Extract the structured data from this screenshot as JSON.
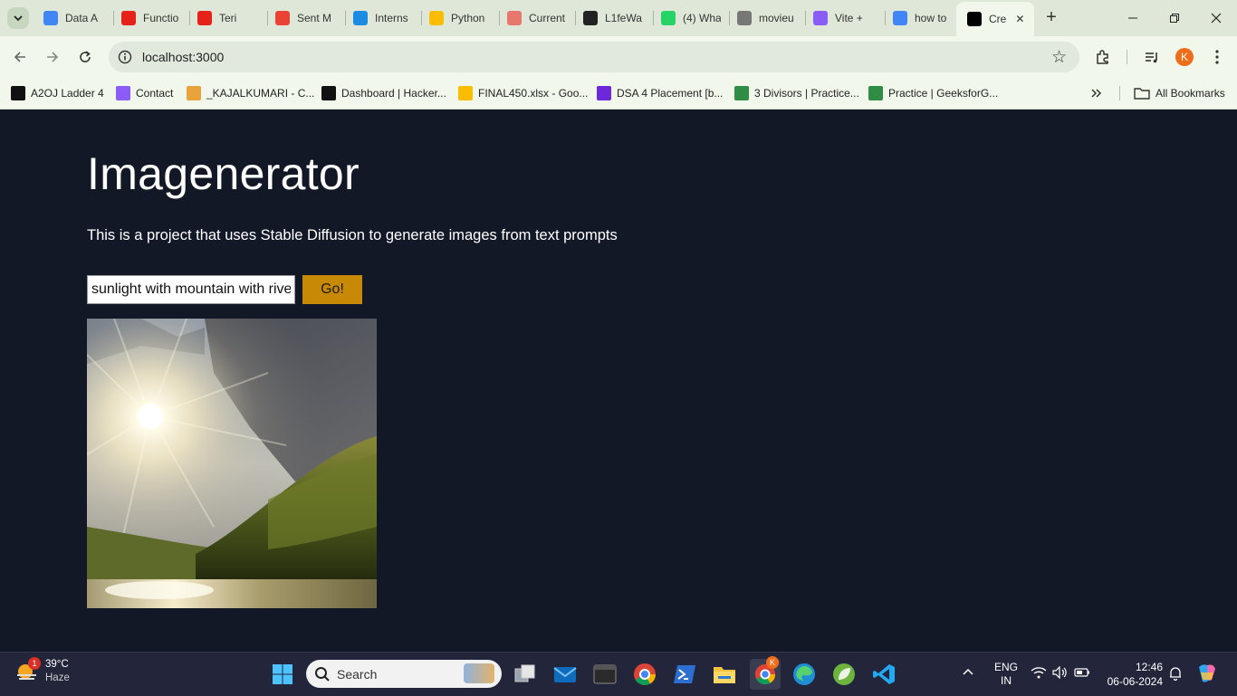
{
  "browser": {
    "tabs": [
      {
        "title": "Data A",
        "favicon": "docs-icon",
        "color": "#4285f4"
      },
      {
        "title": "Functio",
        "favicon": "youtube-icon",
        "color": "#e62117"
      },
      {
        "title": "Teri",
        "favicon": "youtube-icon",
        "color": "#e62117"
      },
      {
        "title": "Sent M",
        "favicon": "gmail-icon",
        "color": "#ea4335"
      },
      {
        "title": "Interns",
        "favicon": "internshala-icon",
        "color": "#1c8ce3"
      },
      {
        "title": "Python",
        "favicon": "drive-icon",
        "color": "#fbbc04"
      },
      {
        "title": "Current",
        "favicon": "claude-icon",
        "color": "#e8776e"
      },
      {
        "title": "L1feWa",
        "favicon": "github-icon",
        "color": "#222222"
      },
      {
        "title": "(4) Wha",
        "favicon": "whatsapp-icon",
        "color": "#25d366"
      },
      {
        "title": "movieu",
        "favicon": "globe-icon",
        "color": "#777777"
      },
      {
        "title": "Vite +",
        "favicon": "vite-icon",
        "color": "#8b5cf6"
      },
      {
        "title": "how to",
        "favicon": "google-icon",
        "color": "#4285f4"
      },
      {
        "title": "Cre",
        "favicon": "nextjs-icon",
        "color": "#000000"
      }
    ],
    "url": "localhost:3000",
    "bookmarks": [
      {
        "label": "A2OJ Ladder 4",
        "icon": "a2oj-icon"
      },
      {
        "label": "Contact",
        "icon": "vite-icon"
      },
      {
        "label": "_KAJALKUMARI - C...",
        "icon": "chart-icon"
      },
      {
        "label": "Dashboard | Hacker...",
        "icon": "hackerrank-icon"
      },
      {
        "label": "FINAL450.xlsx - Goo...",
        "icon": "drive-icon"
      },
      {
        "label": "DSA 4 Placement [b...",
        "icon": "presentation-icon"
      },
      {
        "label": "3 Divisors | Practice...",
        "icon": "geeksforgeeks-icon"
      },
      {
        "label": "Practice | GeeksforG...",
        "icon": "geeksforgeeks-icon"
      }
    ],
    "all_bookmarks": "All Bookmarks",
    "profile_initial": "K"
  },
  "page": {
    "title": "Imagenerator",
    "description": "This is a project that uses Stable Diffusion to generate images from text prompts",
    "prompt_value": "sunlight with mountain with river",
    "button_label": "Go!",
    "accent": "#c88a06",
    "background": "#121826"
  },
  "taskbar": {
    "weather_temp": "39°C",
    "weather_desc": "Haze",
    "weather_badge": "1",
    "search_placeholder": "Search",
    "lang_line1": "ENG",
    "lang_line2": "IN",
    "time": "12:46",
    "date": "06-06-2024",
    "chrome_badge": "K"
  }
}
